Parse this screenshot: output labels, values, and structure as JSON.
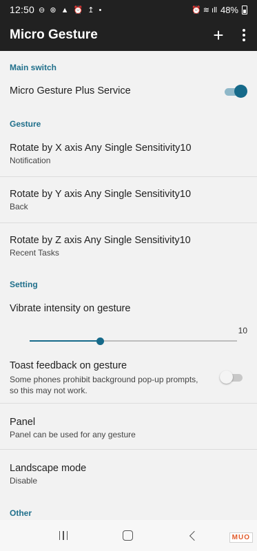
{
  "status_bar": {
    "time": "12:50",
    "left_icons": "⊖ ⊛ ▲ ⏰ ↥ •",
    "right_icons": "⏰ ≋ ıll",
    "battery": "48%"
  },
  "app_bar": {
    "title": "Micro Gesture",
    "add_label": "+",
    "more_label": "more"
  },
  "sections": {
    "main_switch": "Main switch",
    "gesture": "Gesture",
    "setting": "Setting",
    "other": "Other"
  },
  "prefs": {
    "service": {
      "title": "Micro Gesture Plus Service",
      "enabled": true
    },
    "rotate_x": {
      "title": "Rotate by X axis Any Single Sensitivity10",
      "summary": "Notification"
    },
    "rotate_y": {
      "title": "Rotate by Y axis Any Single Sensitivity10",
      "summary": "Back"
    },
    "rotate_z": {
      "title": "Rotate by Z axis Any Single Sensitivity10",
      "summary": "Recent Tasks"
    },
    "vibrate": {
      "title": "Vibrate intensity on gesture",
      "value": "10",
      "fraction": 0.34
    },
    "toast": {
      "title": "Toast feedback on gesture",
      "summary": "Some phones prohibit background pop-up prompts, so this may not work.",
      "enabled": false
    },
    "panel": {
      "title": "Panel",
      "summary": "Panel can be used for any gesture"
    },
    "landscape": {
      "title": "Landscape mode",
      "summary": "Disable"
    }
  },
  "colors": {
    "accent": "#166a8a",
    "category": "#1f6f8b",
    "app_bar": "#212121"
  },
  "watermark": "MUO"
}
